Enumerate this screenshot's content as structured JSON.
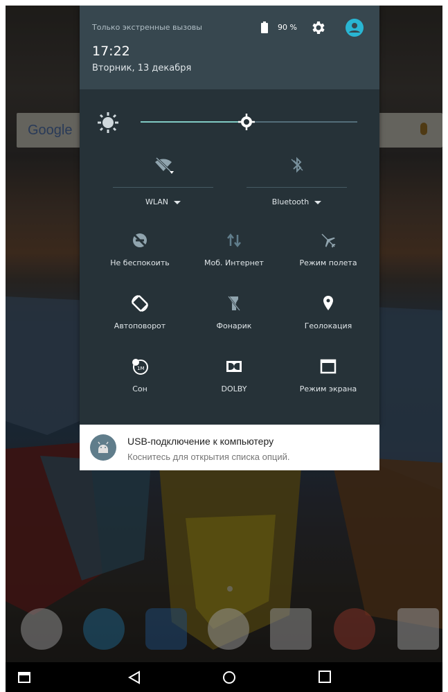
{
  "status": {
    "carrier": "Только экстренные вызовы",
    "time": "17:22",
    "date": "Вторник, 13 декабря",
    "battery": "90 %"
  },
  "brightness": {
    "level": 0.49
  },
  "big_tiles": [
    {
      "label": "WLAN",
      "icon": "wifi-off-icon"
    },
    {
      "label": "Bluetooth",
      "icon": "bluetooth-off-icon"
    }
  ],
  "tiles": [
    {
      "label": "Не беспокоить",
      "icon": "do-not-disturb-icon"
    },
    {
      "label": "Моб. Интернет",
      "icon": "mobile-data-icon"
    },
    {
      "label": "Режим полета",
      "icon": "airplane-icon"
    },
    {
      "label": "Автоповорот",
      "icon": "auto-rotate-icon"
    },
    {
      "label": "Фонарик",
      "icon": "flashlight-icon"
    },
    {
      "label": "Геолокация",
      "icon": "location-icon"
    },
    {
      "label": "Сон",
      "icon": "sleep-icon"
    },
    {
      "label": "DOLBY",
      "icon": "dolby-icon"
    },
    {
      "label": "Режим экрана",
      "icon": "screen-mode-icon"
    }
  ],
  "notification": {
    "title": "USB-подключение к компьютеру",
    "text": "Коснитесь для открытия списка опций."
  },
  "wallpaper": {
    "search_logo": "Google"
  },
  "colors": {
    "panel_bg": "#263238",
    "header_bg": "#37474f",
    "accent": "#80cbc4",
    "avatar": "#29b6d3"
  }
}
